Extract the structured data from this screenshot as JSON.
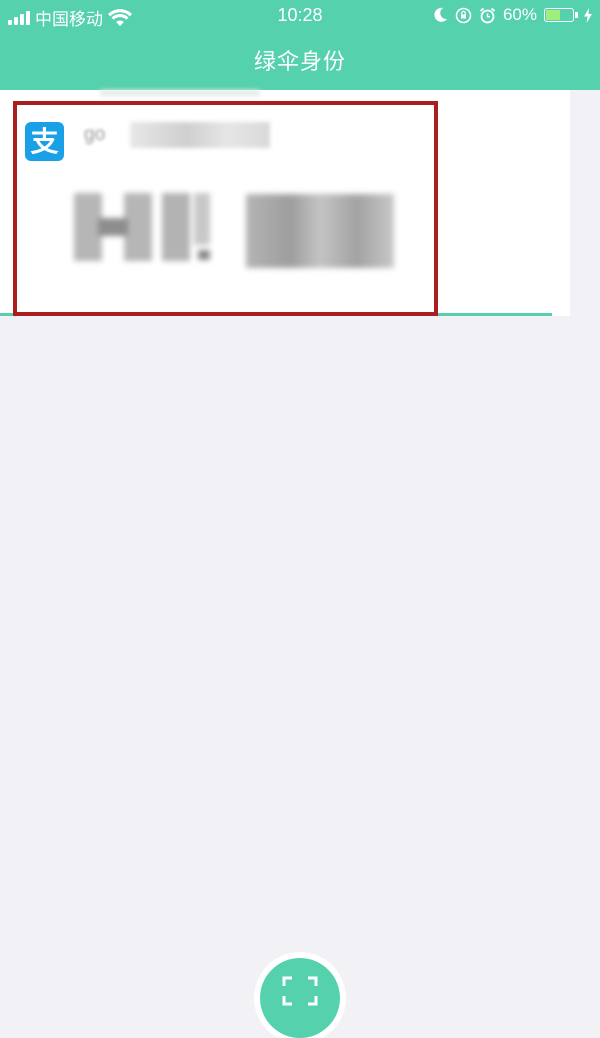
{
  "status_bar": {
    "carrier": "中国移动",
    "time": "10:28",
    "battery": "60%",
    "battery_level": 0.6,
    "icons": [
      "signal-icon",
      "wifi-icon",
      "moon-icon",
      "lock-rotation-icon",
      "alarm-icon",
      "battery-icon",
      "charging-icon"
    ]
  },
  "header": {
    "title": "绿伞身份"
  },
  "card": {
    "app_icon": "alipay-icon",
    "app_icon_glyph": "支",
    "account_prefix": "go"
  },
  "colors": {
    "header_bg": "#55d1ae",
    "highlight_border": "#a91e1e",
    "alipay_blue": "#1aa0e6",
    "page_bg": "#f2f2f6"
  },
  "bottom": {
    "scan_button_icon": "scan-icon"
  }
}
